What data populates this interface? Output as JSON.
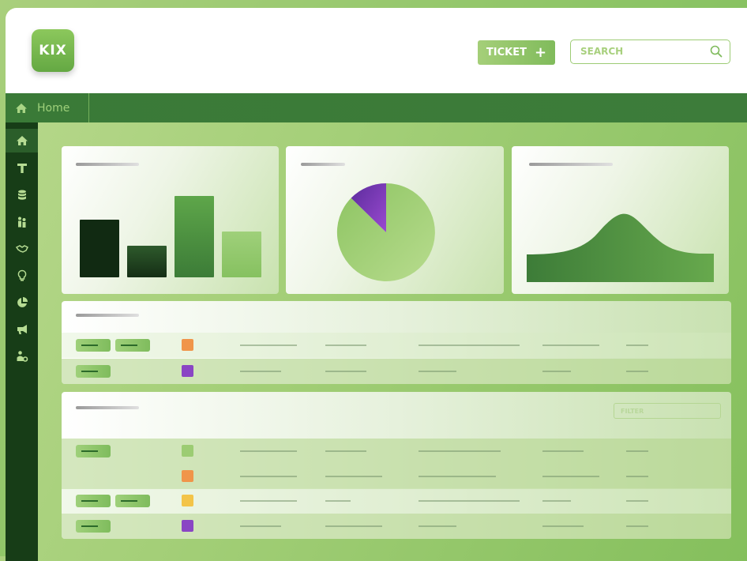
{
  "app": {
    "logo_text": "KIX"
  },
  "header": {
    "ticket_button": {
      "label": "TICKET",
      "icon": "plus-icon"
    },
    "search": {
      "placeholder": "SEARCH",
      "icon": "search-icon"
    }
  },
  "breadcrumb": {
    "home_label": "Home",
    "icon": "home-icon"
  },
  "sidebar": {
    "items": [
      {
        "icon": "home-icon",
        "active": true
      },
      {
        "icon": "text-t-icon"
      },
      {
        "icon": "database-icon"
      },
      {
        "icon": "users-icon"
      },
      {
        "icon": "handshake-icon"
      },
      {
        "icon": "lightbulb-icon"
      },
      {
        "icon": "pie-chart-icon"
      },
      {
        "icon": "megaphone-icon"
      },
      {
        "icon": "user-gear-icon"
      }
    ]
  },
  "widgets": {
    "bar_chart": {
      "bars": [
        0.71,
        0.38,
        1.0,
        0.57
      ]
    },
    "pie_chart": {
      "slices": [
        {
          "value": 0.875,
          "color": "#9dcd71"
        },
        {
          "value": 0.125,
          "color": "#7a2fb8"
        }
      ]
    },
    "area_chart": {
      "shape": "bell-curve"
    }
  },
  "table1": {
    "rows": [
      {
        "pills": 2,
        "status_color": "#f0954a"
      },
      {
        "pills": 1,
        "status_color": "#8a45c4"
      }
    ]
  },
  "table2": {
    "filter_placeholder": "FILTER",
    "rows": [
      {
        "pills": 1,
        "status_color": "#9ccc73"
      },
      {
        "pills": 0,
        "status_color": "#f0954a"
      },
      {
        "pills": 2,
        "status_color": "#f3c448"
      },
      {
        "pills": 1,
        "status_color": "#8a45c4"
      }
    ]
  },
  "colors": {
    "accent": "#8cc465",
    "dark_green": "#173d17",
    "bar_green": "#3d7c3a"
  }
}
